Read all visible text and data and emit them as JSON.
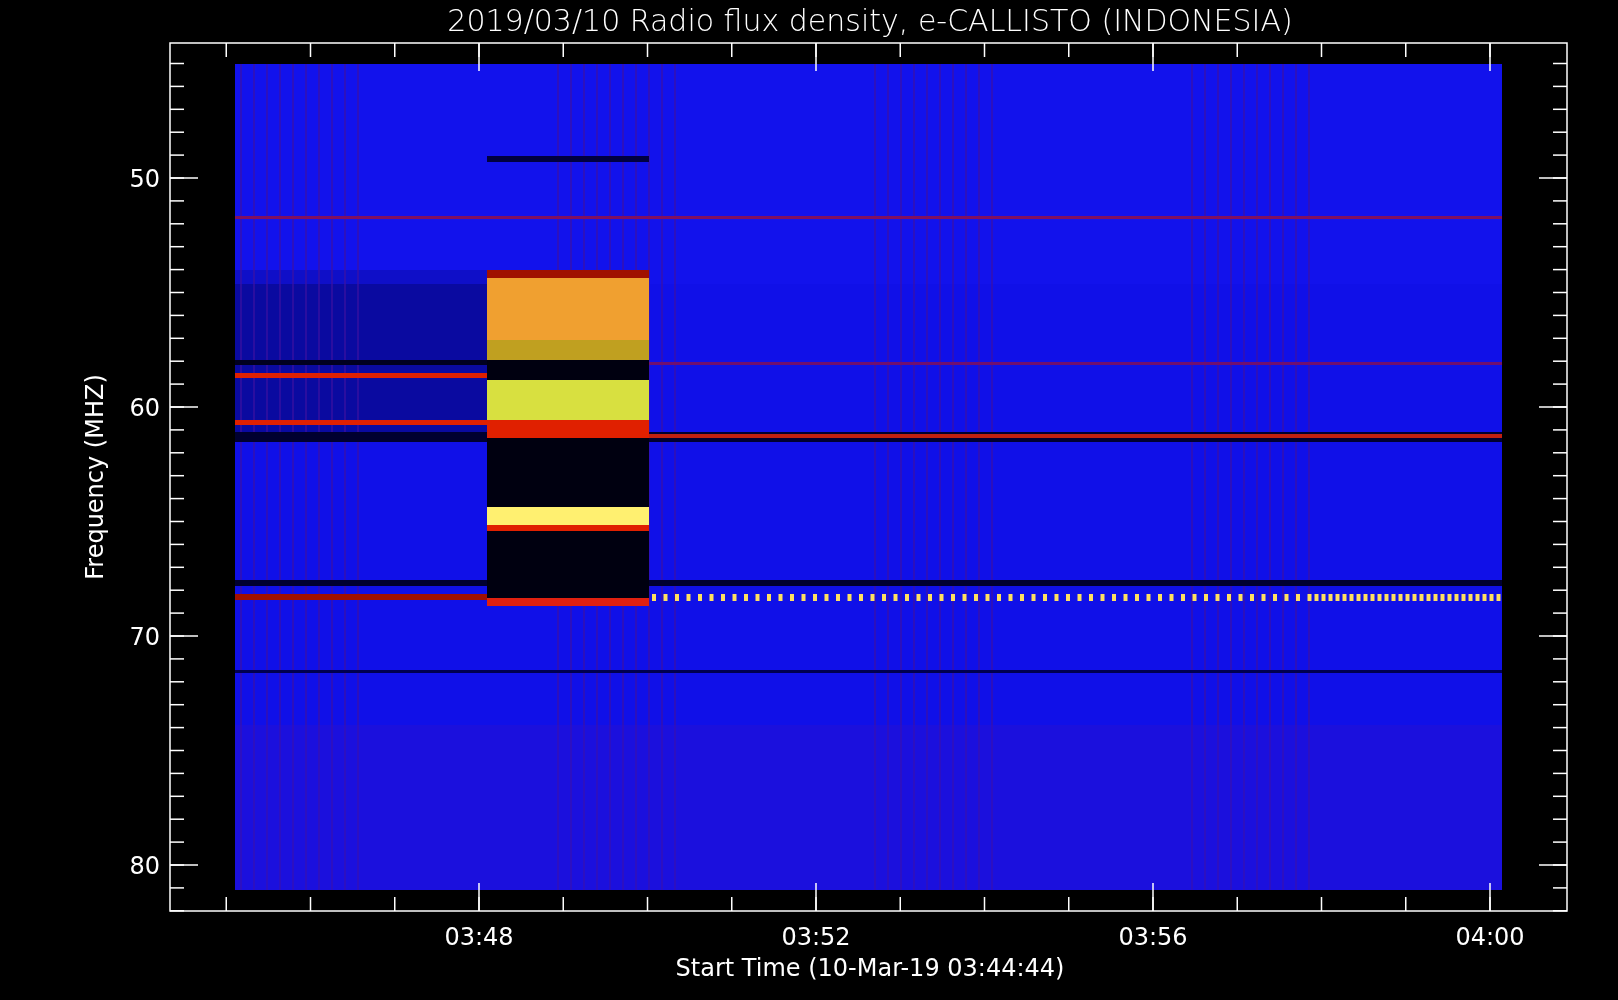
{
  "title": "2019/03/10  Radio flux density, e-CALLISTO (INDONESIA)",
  "y_axis": {
    "label": "Frequency (MHZ)",
    "ticks": [
      "50",
      "60",
      "70",
      "80"
    ]
  },
  "x_axis": {
    "label": "Start Time (10-Mar-19 03:44:44)",
    "ticks": [
      "03:48",
      "03:52",
      "03:56",
      "04:00"
    ]
  }
}
